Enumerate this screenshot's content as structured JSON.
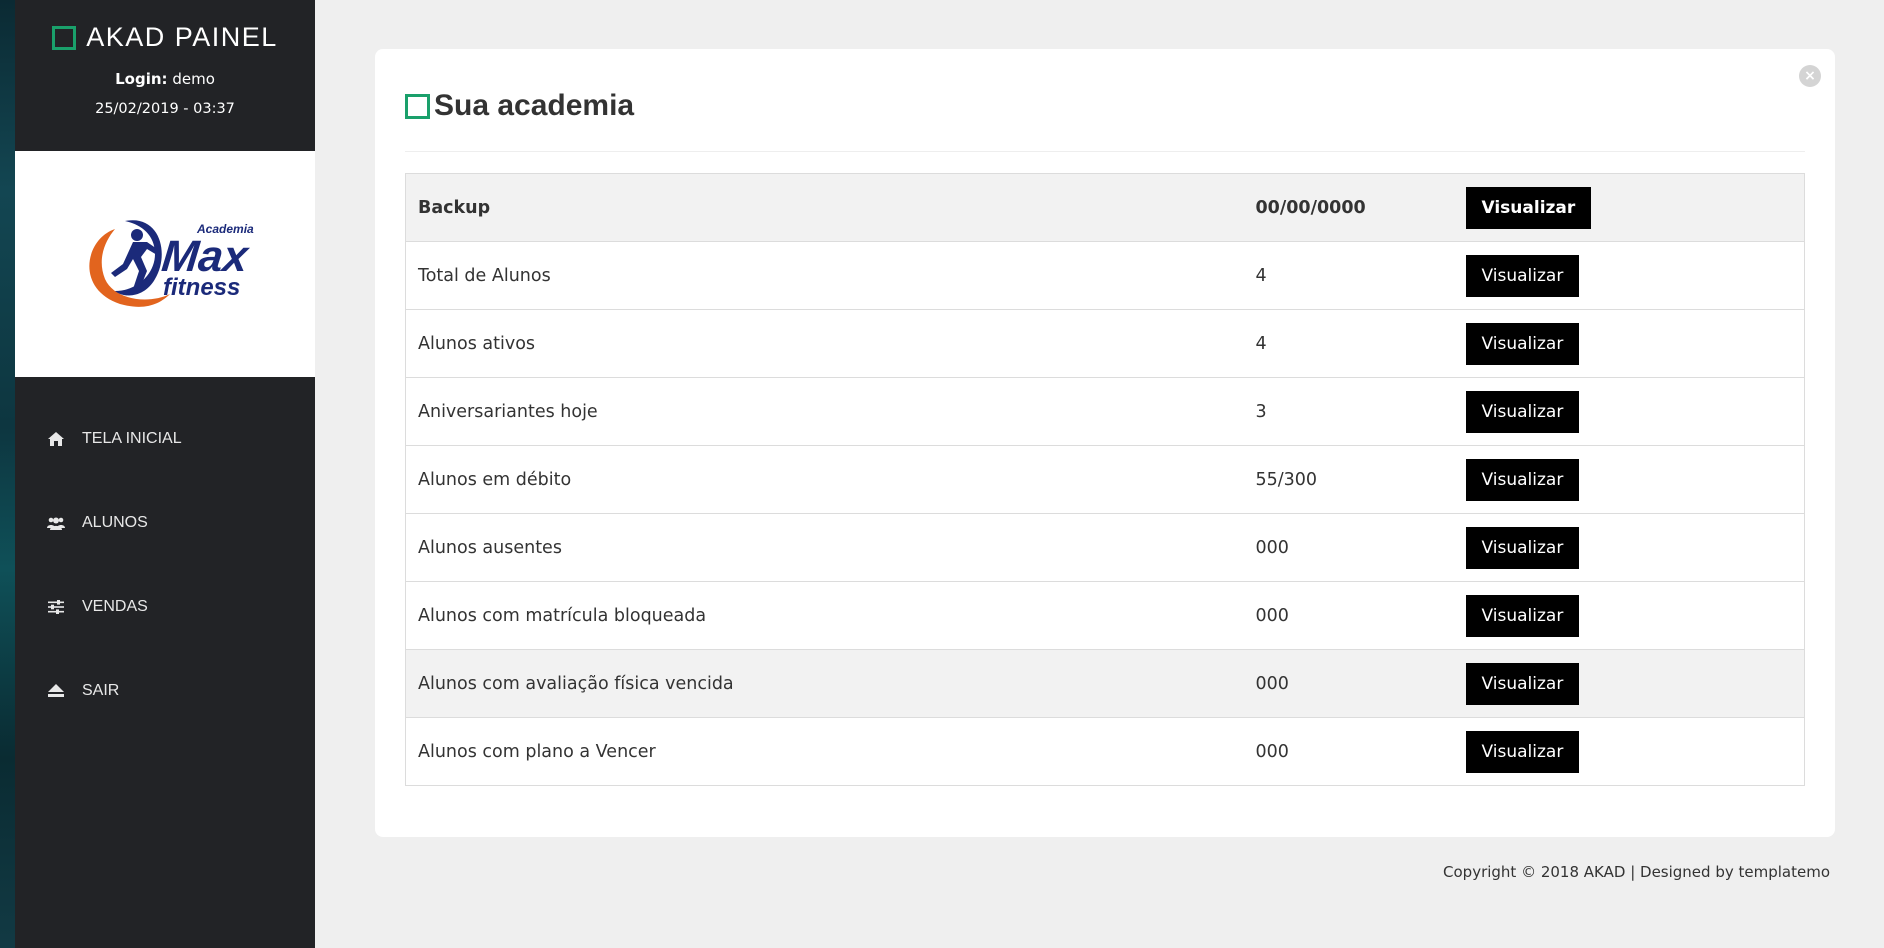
{
  "app": {
    "title": "AKAD PAINEL",
    "login_label": "Login:",
    "login_user": "demo",
    "datetime": "25/02/2019 - 03:37"
  },
  "logo": {
    "top_text": "Academia",
    "main_text": "Max",
    "sub_text": "fitness",
    "colors": {
      "blue": "#1b2a7a",
      "orange": "#e2641e"
    }
  },
  "nav": {
    "items": [
      {
        "label": "TELA INICIAL",
        "icon": "home-icon"
      },
      {
        "label": "ALUNOS",
        "icon": "users-icon"
      },
      {
        "label": "VENDAS",
        "icon": "sliders-icon"
      },
      {
        "label": "SAIR",
        "icon": "eject-icon"
      }
    ]
  },
  "main": {
    "title": "Sua academia",
    "close_symbol": "×",
    "table": {
      "header": {
        "label": "Backup",
        "value": "00/00/0000",
        "action": "Visualizar"
      },
      "rows": [
        {
          "label": "Total de Alunos",
          "value": "4",
          "action": "Visualizar"
        },
        {
          "label": "Alunos ativos",
          "value": "4",
          "action": "Visualizar"
        },
        {
          "label": "Aniversariantes hoje",
          "value": "3",
          "action": "Visualizar"
        },
        {
          "label": "Alunos em débito",
          "value": "55/300",
          "action": "Visualizar"
        },
        {
          "label": "Alunos ausentes",
          "value": "000",
          "action": "Visualizar"
        },
        {
          "label": "Alunos com matrícula bloqueada",
          "value": "000",
          "action": "Visualizar"
        },
        {
          "label": "Alunos com avaliação física vencida",
          "value": "000",
          "action": "Visualizar"
        },
        {
          "label": "Alunos com plano a Vencer",
          "value": "000",
          "action": "Visualizar"
        }
      ]
    }
  },
  "footer": {
    "text": "Copyright © 2018 AKAD | Designed by templatemo"
  },
  "colors": {
    "sidebar_bg": "#222326",
    "accent_green": "#1aa06b",
    "button_bg": "#000000",
    "page_bg": "#efefef"
  }
}
